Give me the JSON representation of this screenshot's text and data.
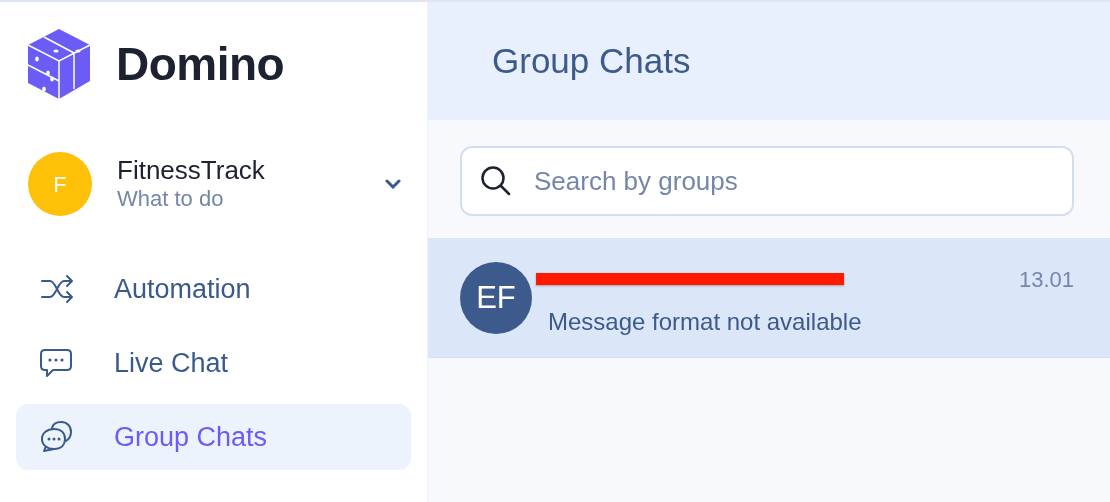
{
  "brand": {
    "name": "Domino"
  },
  "workspace": {
    "initial": "F",
    "name": "FitnessTrack",
    "subtitle": "What to do"
  },
  "nav": [
    {
      "kind": "automation",
      "label": "Automation",
      "selected": false
    },
    {
      "kind": "livechat",
      "label": "Live Chat",
      "selected": false
    },
    {
      "kind": "groupchats",
      "label": "Group Chats",
      "selected": true
    }
  ],
  "header": {
    "title": "Group Chats"
  },
  "search": {
    "placeholder": "Search by groups"
  },
  "chats": [
    {
      "initials": "EF",
      "title_redacted": true,
      "time": "13.01",
      "preview": "Message format not available",
      "selected": true
    }
  ]
}
